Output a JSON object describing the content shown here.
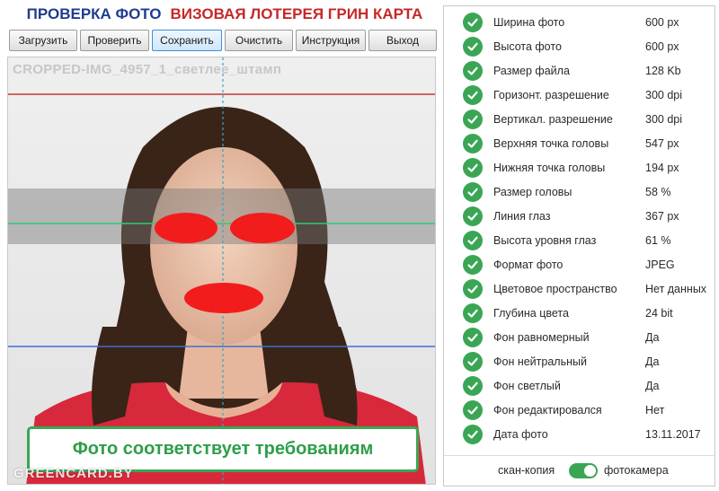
{
  "header": {
    "title_part1": "ПРОВЕРКА ФОТО",
    "title_part2": "ВИЗОВАЯ ЛОТЕРЕЯ ГРИН КАРТА"
  },
  "toolbar": {
    "buttons": [
      {
        "label": "Загрузить"
      },
      {
        "label": "Проверить"
      },
      {
        "label": "Сохранить"
      },
      {
        "label": "Очистить"
      },
      {
        "label": "Инструкция"
      },
      {
        "label": "Выход"
      }
    ]
  },
  "photo": {
    "filename": "CROPPED-IMG_4957_1_светлее_штамп",
    "status_message": "Фото соответствует требованиям",
    "watermark": "GREENCARD.BY"
  },
  "results": [
    {
      "label": "Ширина фото",
      "value": "600 px"
    },
    {
      "label": "Высота фото",
      "value": "600 px"
    },
    {
      "label": "Размер файла",
      "value": "128 Kb"
    },
    {
      "label": "Горизонт. разрешение",
      "value": "300 dpi"
    },
    {
      "label": "Вертикал. разрешение",
      "value": "300 dpi"
    },
    {
      "label": "Верхняя точка головы",
      "value": "547 px"
    },
    {
      "label": "Нижняя точка головы",
      "value": "194 px"
    },
    {
      "label": "Размер головы",
      "value": "58 %"
    },
    {
      "label": "Линия глаз",
      "value": "367 px"
    },
    {
      "label": "Высота уровня глаз",
      "value": "61 %"
    },
    {
      "label": "Формат фото",
      "value": "JPEG"
    },
    {
      "label": "Цветовое пространство",
      "value": "Нет данных"
    },
    {
      "label": "Глубина цвета",
      "value": "24 bit"
    },
    {
      "label": "Фон равномерный",
      "value": "Да"
    },
    {
      "label": "Фон нейтральный",
      "value": "Да"
    },
    {
      "label": "Фон светлый",
      "value": "Да"
    },
    {
      "label": "Фон редактировался",
      "value": "Нет"
    },
    {
      "label": "Дата фото",
      "value": "13.11.2017"
    }
  ],
  "mode_switch": {
    "left_label": "скан-копия",
    "right_label": "фотокамера",
    "selected": "фотокамера"
  },
  "colors": {
    "title_blue": "#1f3c8f",
    "title_red": "#c62828",
    "ok_green": "#3aa655",
    "redaction_red": "#f21c1c"
  }
}
